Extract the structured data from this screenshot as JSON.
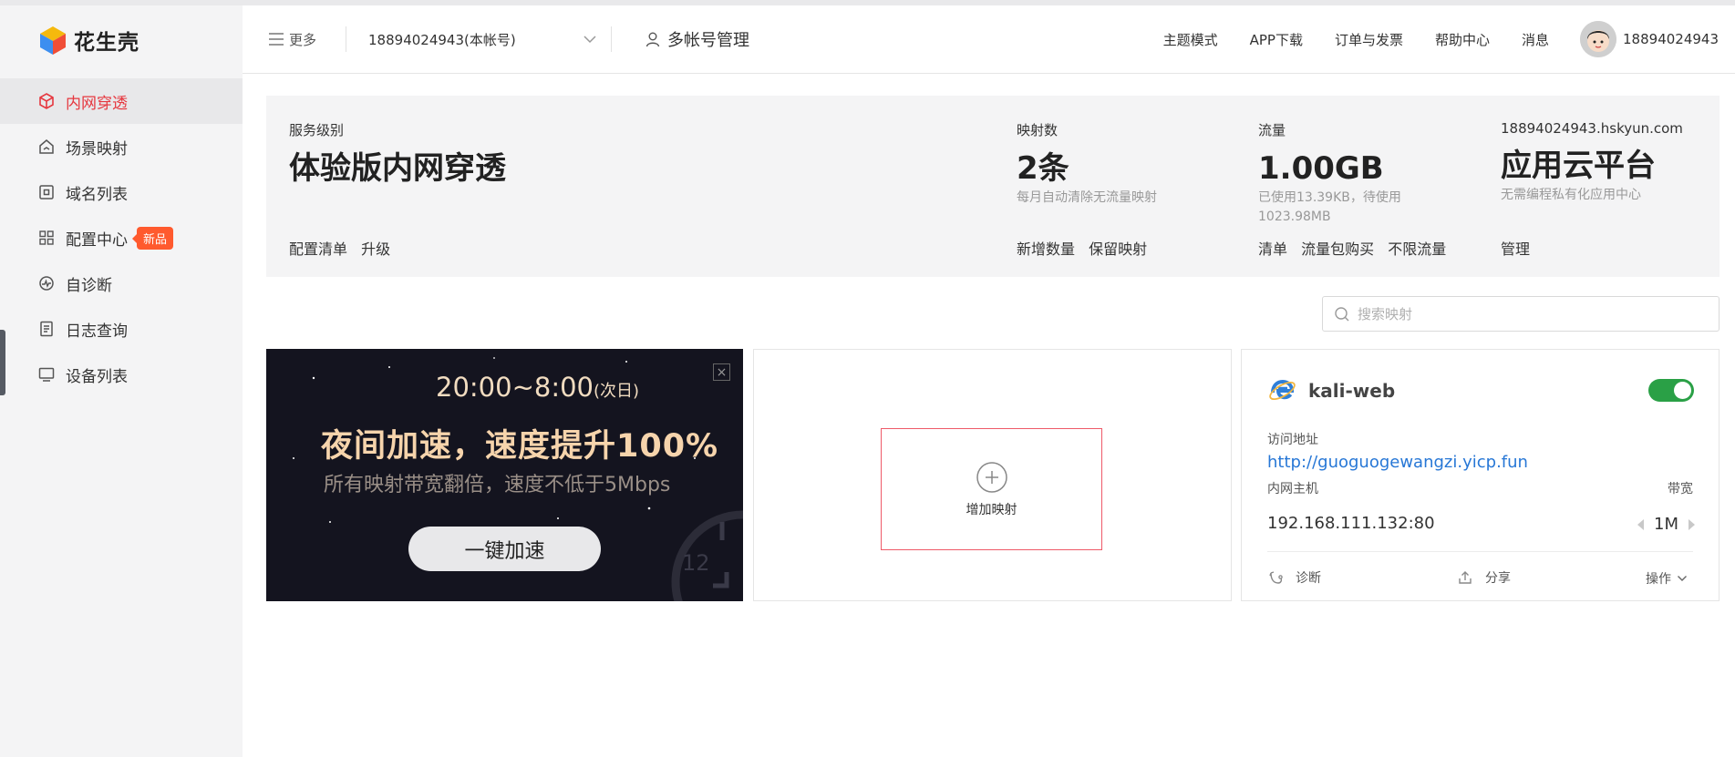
{
  "brand": {
    "name": "花生壳"
  },
  "sidebar": {
    "items": [
      {
        "label": "内网穿透",
        "icon": "cube-icon",
        "active": true
      },
      {
        "label": "场景映射",
        "icon": "home-icon"
      },
      {
        "label": "域名列表",
        "icon": "domain-icon"
      },
      {
        "label": "配置中心",
        "icon": "grid-icon",
        "badge": "新品"
      },
      {
        "label": "自诊断",
        "icon": "diagnose-icon"
      },
      {
        "label": "日志查询",
        "icon": "log-icon"
      },
      {
        "label": "设备列表",
        "icon": "monitor-icon"
      }
    ]
  },
  "header": {
    "more_label": "更多",
    "account_select": "18894024943(本帐号)",
    "multi_account_label": "多帐号管理",
    "links": [
      "主题模式",
      "APP下载",
      "订单与发票",
      "帮助中心",
      "消息"
    ],
    "username": "18894024943"
  },
  "summary": {
    "service": {
      "label": "服务级别",
      "value": "体验版内网穿透",
      "actions": [
        "配置清单",
        "升级"
      ]
    },
    "mappings": {
      "label": "映射数",
      "value": "2条",
      "sub": "每月自动清除无流量映射",
      "actions": [
        "新增数量",
        "保留映射"
      ]
    },
    "traffic": {
      "label": "流量",
      "value": "1.00GB",
      "sub1": "已使用13.39KB，待使用",
      "sub2": "1023.98MB",
      "actions": [
        "清单",
        "流量包购买",
        "不限流量"
      ]
    },
    "cloud": {
      "label": "18894024943.hskyun.com",
      "value": "应用云平台",
      "sub": "无需编程私有化应用中心",
      "actions": [
        "管理"
      ]
    }
  },
  "search": {
    "placeholder": "搜索映射"
  },
  "promo": {
    "time": "20:00~8:00",
    "time_note": "(次日)",
    "title": "夜间加速，速度提升100%",
    "subtitle": "所有映射带宽翻倍，速度不低于5Mbps",
    "button": "一键加速",
    "clock_number": "12"
  },
  "add_card": {
    "label": "增加映射"
  },
  "mapping_card": {
    "name": "kali-web",
    "enabled": true,
    "access_label": "访问地址",
    "url": "http://guoguogewangzi.yicp.fun",
    "host_label": "内网主机",
    "host": "192.168.111.132:80",
    "bandwidth_label": "带宽",
    "bandwidth": "1M",
    "actions": {
      "diagnose": "诊断",
      "share": "分享",
      "ops": "操作"
    }
  },
  "colors": {
    "accent_red": "#e6373f",
    "link_blue": "#2777d6",
    "toggle_green": "#2aa046",
    "badge_orange": "#ff5a2e"
  }
}
